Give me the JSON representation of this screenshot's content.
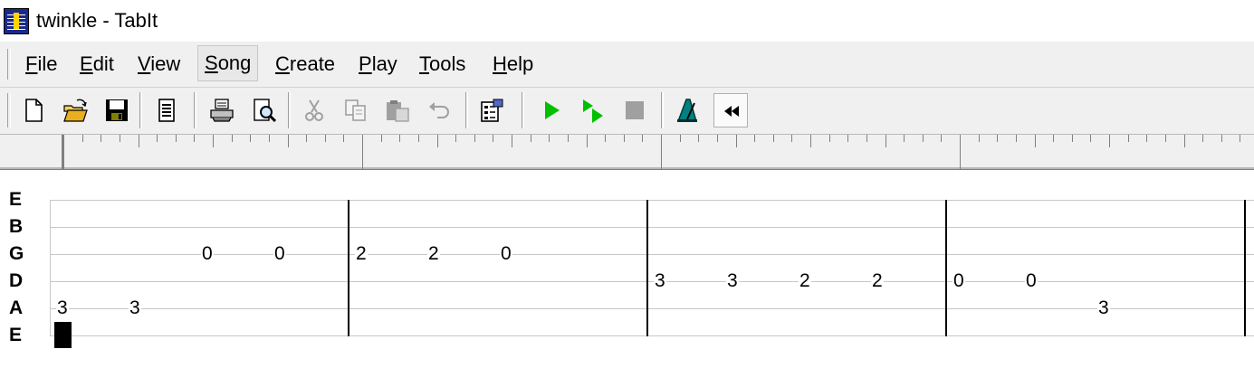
{
  "window": {
    "title": "twinkle - TabIt"
  },
  "menu": [
    {
      "label": "File",
      "key": "F",
      "rest": "ile",
      "id": "file"
    },
    {
      "label": "Edit",
      "key": "E",
      "rest": "dit",
      "id": "edit"
    },
    {
      "label": "View",
      "key": "V",
      "rest": "iew",
      "id": "view"
    },
    {
      "label": "Song",
      "key": "S",
      "rest": "ong",
      "id": "song",
      "active": true
    },
    {
      "label": "Create",
      "key": "C",
      "rest": "reate",
      "id": "create"
    },
    {
      "label": "Play",
      "key": "P",
      "rest": "lay",
      "id": "play"
    },
    {
      "label": "Tools",
      "key": "T",
      "rest": "ools",
      "id": "tools"
    },
    {
      "label": "Help",
      "key": "H",
      "rest": "elp",
      "id": "help"
    }
  ],
  "toolbar": [
    {
      "icon": "new-document-icon",
      "enabled": true
    },
    {
      "icon": "open-folder-icon",
      "enabled": true
    },
    {
      "icon": "save-disk-icon",
      "enabled": true
    },
    {
      "icon": "song-properties-icon",
      "enabled": true
    },
    {
      "icon": "print-icon",
      "enabled": true
    },
    {
      "icon": "print-preview-icon",
      "enabled": true
    },
    {
      "icon": "cut-icon",
      "enabled": false
    },
    {
      "icon": "copy-icon",
      "enabled": false
    },
    {
      "icon": "paste-icon",
      "enabled": false
    },
    {
      "icon": "undo-icon",
      "enabled": false
    },
    {
      "icon": "settings-icon",
      "enabled": true
    },
    {
      "icon": "play-icon",
      "enabled": true
    },
    {
      "icon": "play-from-cursor-icon",
      "enabled": true
    },
    {
      "icon": "stop-icon",
      "enabled": false
    },
    {
      "icon": "metronome-icon",
      "enabled": true
    },
    {
      "icon": "rewind-icon",
      "enabled": true,
      "pressed": true
    }
  ],
  "colors": {
    "play_green": "#00c000",
    "metronome_teal": "#008080",
    "disabled_gray": "#a0a0a0",
    "staff_line": "#c8c8c8",
    "cursor": "#000000"
  },
  "tab": {
    "strings": [
      "E",
      "B",
      "G",
      "D",
      "A",
      "E"
    ],
    "notes": [
      {
        "string": 4,
        "slot": 0,
        "fret": "3"
      },
      {
        "string": 4,
        "slot": 1,
        "fret": "3"
      },
      {
        "string": 2,
        "slot": 2,
        "fret": "0"
      },
      {
        "string": 2,
        "slot": 3,
        "fret": "0"
      },
      {
        "string": 2,
        "slot": 4,
        "fret": "2"
      },
      {
        "string": 2,
        "slot": 5,
        "fret": "2"
      },
      {
        "string": 2,
        "slot": 6,
        "fret": "0"
      },
      {
        "string": 3,
        "slot": 8,
        "fret": "3"
      },
      {
        "string": 3,
        "slot": 9,
        "fret": "3"
      },
      {
        "string": 3,
        "slot": 10,
        "fret": "2"
      },
      {
        "string": 3,
        "slot": 11,
        "fret": "2"
      },
      {
        "string": 3,
        "slot": 12,
        "fret": "0"
      },
      {
        "string": 3,
        "slot": 13,
        "fret": "0"
      },
      {
        "string": 4,
        "slot": 14,
        "fret": "3"
      }
    ],
    "cursor": {
      "string": 5,
      "slot": 0
    }
  }
}
